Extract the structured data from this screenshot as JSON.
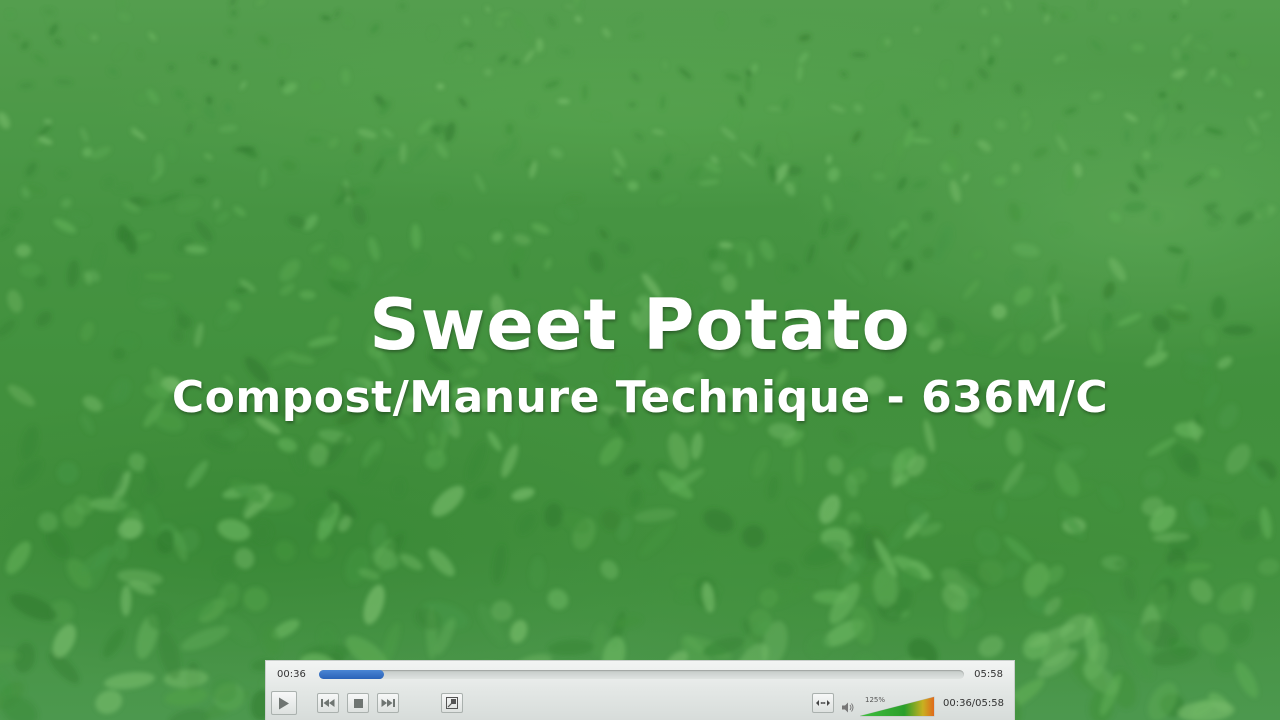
{
  "video": {
    "title": "Sweet Potato",
    "subtitle": "Compost/Manure Technique - 636M/C"
  },
  "player": {
    "elapsed": "00:36",
    "duration": "05:58",
    "progress_fraction": 0.1,
    "volume_label": "125%",
    "volume_fraction": 1.0,
    "time_readout": "00:36/05:58",
    "icons": {
      "play": "play-icon",
      "prev": "skip-back-icon",
      "stop": "stop-icon",
      "next": "skip-forward-icon",
      "fullscreen": "fullscreen-icon",
      "aspect": "aspect-ratio-icon",
      "volume": "speaker-icon"
    },
    "colors": {
      "seek_fill": "#2a63b8",
      "volume_low": "#2fb02f",
      "volume_high": "#e06a1c"
    }
  }
}
